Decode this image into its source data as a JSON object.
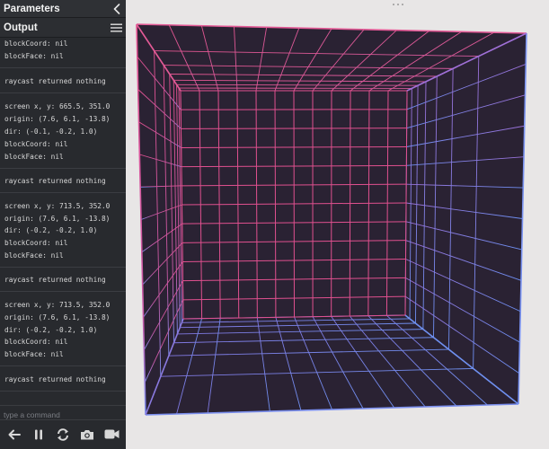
{
  "sidebar": {
    "parameters_title": "Parameters",
    "output_title": "Output",
    "log_lines": [
      "blockCoord: nil",
      "blockFace: nil",
      "raycast returned nothing",
      "screen x, y: 665.5, 351.0",
      "origin: (7.6, 6.1, -13.8)",
      "dir: (-0.1, -0.2, 1.0)",
      "blockCoord: nil",
      "blockFace: nil",
      "raycast returned nothing",
      "screen x, y: 713.5, 352.0",
      "origin: (7.6, 6.1, -13.8)",
      "dir: (-0.2, -0.2, 1.0)",
      "blockCoord: nil",
      "blockFace: nil",
      "raycast returned nothing",
      "screen x, y: 713.5, 352.0",
      "origin: (7.6, 6.1, -13.8)",
      "dir: (-0.2, -0.2, 1.0)",
      "blockCoord: nil",
      "blockFace: nil",
      "raycast returned nothing"
    ],
    "command_placeholder": "type a command",
    "toolbar": {
      "icons": [
        "back-icon",
        "pause-icon",
        "restart-icon",
        "camera-icon",
        "video-icon"
      ]
    }
  },
  "viewport": {
    "colors": {
      "background": "#2a2233",
      "grid_pink": "#e0508f",
      "grid_blue": "#6f8ef0"
    }
  }
}
